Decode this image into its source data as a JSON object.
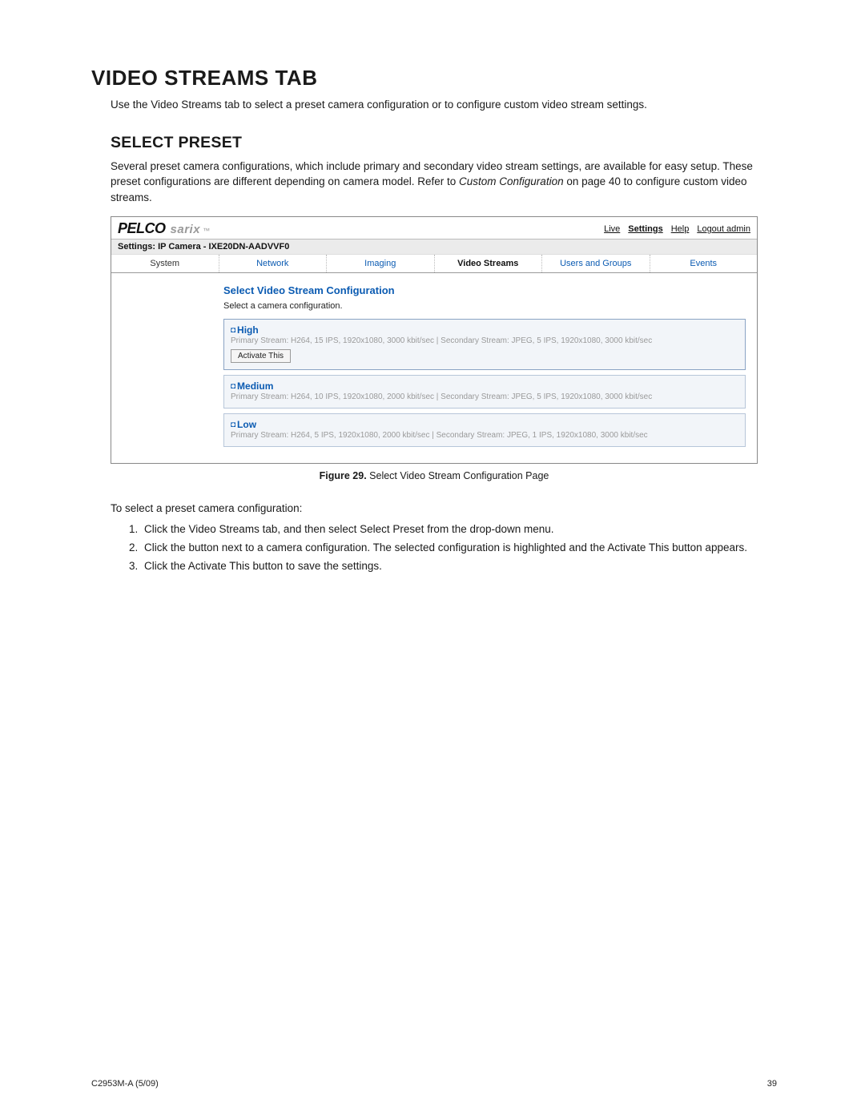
{
  "page_title": "VIDEO STREAMS TAB",
  "intro": "Use the Video Streams tab to select a preset camera configuration or to configure custom video stream settings.",
  "section_title": "SELECT PRESET",
  "section_body_before": "Several preset camera configurations, which include primary and secondary video stream settings, are available for easy setup. These preset configurations are different depending on camera model. Refer to ",
  "section_body_xref": "Custom Configuration",
  "section_body_after": " on page 40 to configure custom video streams.",
  "figure": {
    "label": "Figure 29.",
    "caption": "Select Video Stream Configuration Page"
  },
  "screenshot": {
    "brand_pelco": "PELCO",
    "brand_sarix": "sarix",
    "brand_tm": "™",
    "top_links": {
      "live": "Live",
      "settings": "Settings",
      "help": "Help",
      "logout": "Logout admin"
    },
    "settings_line": "Settings: IP Camera - IXE20DN-AADVVF0",
    "tabs": {
      "system": "System",
      "network": "Network",
      "imaging": "Imaging",
      "video_streams": "Video Streams",
      "users_groups": "Users and Groups",
      "events": "Events"
    },
    "config_title": "Select Video Stream Configuration",
    "config_sub": "Select a camera configuration.",
    "presets": {
      "high": {
        "name": "High",
        "desc": "Primary Stream: H264, 15 IPS, 1920x1080, 3000 kbit/sec | Secondary Stream: JPEG, 5 IPS, 1920x1080, 3000 kbit/sec",
        "button": "Activate This"
      },
      "medium": {
        "name": "Medium",
        "desc": "Primary Stream: H264, 10 IPS, 1920x1080, 2000 kbit/sec | Secondary Stream: JPEG, 5 IPS, 1920x1080, 3000 kbit/sec"
      },
      "low": {
        "name": "Low",
        "desc": "Primary Stream: H264, 5 IPS, 1920x1080, 2000 kbit/sec | Secondary Stream: JPEG, 1 IPS, 1920x1080, 3000 kbit/sec"
      }
    }
  },
  "steps_intro": "To select a preset camera configuration:",
  "steps": {
    "s1": "Click the Video Streams tab, and then select Select Preset from the drop-down menu.",
    "s2": "Click the button next to a camera configuration. The selected configuration is highlighted and the Activate This button appears.",
    "s3": "Click the Activate This button to save the settings."
  },
  "footer": {
    "left": "C2953M-A (5/09)",
    "right": "39"
  }
}
